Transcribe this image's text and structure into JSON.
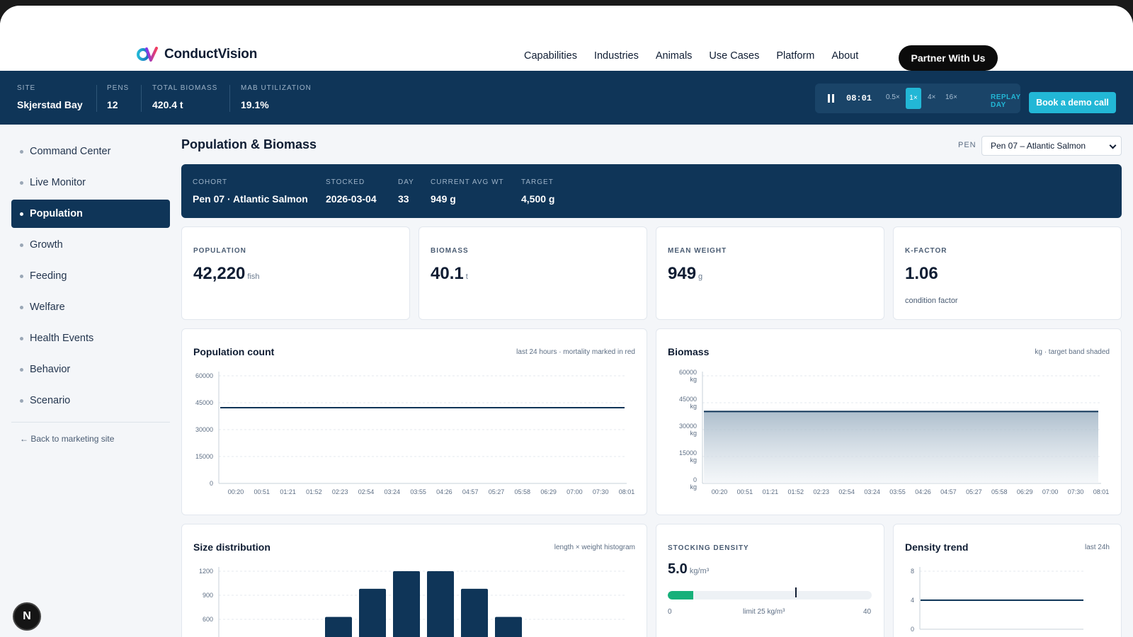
{
  "brand": {
    "name": "ConductVision"
  },
  "nav": {
    "links": [
      "Capabilities",
      "Industries",
      "Animals",
      "Use Cases",
      "Platform",
      "About"
    ],
    "cta": "Partner With Us"
  },
  "infobar": {
    "stats": [
      {
        "label": "SITE",
        "value": "Skjerstad Bay"
      },
      {
        "label": "PENS",
        "value": "12"
      },
      {
        "label": "TOTAL BIOMASS",
        "value": "420.4 t"
      },
      {
        "label": "MAB UTILIZATION",
        "value": "19.1%"
      }
    ],
    "playback": {
      "time": "08:01",
      "speeds": [
        "0.5×",
        "1×",
        "4×",
        "16×"
      ],
      "active_speed": "1×",
      "replay": "REPLAY DAY"
    },
    "demo_cta": "Book a demo call"
  },
  "sidebar": {
    "items": [
      "Command Center",
      "Live Monitor",
      "Population",
      "Growth",
      "Feeding",
      "Welfare",
      "Health Events",
      "Behavior",
      "Scenario"
    ],
    "active": "Population",
    "back": "← Back to marketing site"
  },
  "page": {
    "title": "Population & Biomass",
    "pen_label": "PEN",
    "pen_selected": "Pen 07 – Atlantic Salmon"
  },
  "cohort": [
    {
      "label": "COHORT",
      "value": "Pen 07 · Atlantic Salmon"
    },
    {
      "label": "STOCKED",
      "value": "2026-03-04"
    },
    {
      "label": "DAY",
      "value": "33"
    },
    {
      "label": "CURRENT AVG WT",
      "value": "949 g"
    },
    {
      "label": "TARGET",
      "value": "4,500 g"
    }
  ],
  "kpis": [
    {
      "label": "POPULATION",
      "value": "42,220",
      "unit": "fish",
      "sub": ""
    },
    {
      "label": "BIOMASS",
      "value": "40.1",
      "unit": "t",
      "sub": ""
    },
    {
      "label": "MEAN WEIGHT",
      "value": "949",
      "unit": "g",
      "sub": ""
    },
    {
      "label": "K-FACTOR",
      "value": "1.06",
      "unit": "",
      "sub": "condition factor"
    }
  ],
  "charts": {
    "population": {
      "title": "Population count",
      "note": "last 24 hours · mortality marked in red"
    },
    "biomass": {
      "title": "Biomass",
      "note": "kg · target band shaded"
    },
    "size": {
      "title": "Size distribution",
      "note": "length × weight histogram"
    },
    "density_trend": {
      "title": "Density trend",
      "note": "last 24h"
    }
  },
  "density": {
    "label": "STOCKING DENSITY",
    "value": "5.0",
    "unit": "kg/m³",
    "fill_fraction": 0.125,
    "limit_fraction": 0.625,
    "scale_min": "0",
    "scale_max": "40",
    "limit_label": "limit 25 kg/m³"
  },
  "avatar": "N",
  "colors": {
    "navy": "#0f3558",
    "accent": "#22b7d6",
    "green": "#17b07a"
  },
  "chart_data": [
    {
      "type": "line",
      "title": "Population count",
      "x": [
        "00:20",
        "00:51",
        "01:21",
        "01:52",
        "02:23",
        "02:54",
        "03:24",
        "03:55",
        "04:26",
        "04:57",
        "05:27",
        "05:58",
        "06:29",
        "07:00",
        "07:30",
        "08:01"
      ],
      "series": [
        {
          "values": [
            42220,
            42220,
            42220,
            42220,
            42220,
            42220,
            42220,
            42220,
            42220,
            42220,
            42220,
            42220,
            42220,
            42220,
            42220,
            42220
          ]
        }
      ],
      "yticks": [
        "0",
        "15000",
        "30000",
        "45000",
        "60000"
      ],
      "ylim": [
        0,
        60000
      ],
      "grid": true
    },
    {
      "type": "area",
      "title": "Biomass",
      "x": [
        "00:20",
        "00:51",
        "01:21",
        "01:52",
        "02:23",
        "02:54",
        "03:24",
        "03:55",
        "04:26",
        "04:57",
        "05:27",
        "05:58",
        "06:29",
        "07:00",
        "07:30",
        "08:01"
      ],
      "series": [
        {
          "values": [
            40100,
            40100,
            40100,
            40100,
            40100,
            40100,
            40100,
            40100,
            40100,
            40100,
            40100,
            40100,
            40100,
            40100,
            40100,
            40100
          ]
        }
      ],
      "yticks": [
        "0 kg",
        "15000 kg",
        "30000 kg",
        "45000 kg",
        "60000 kg"
      ],
      "ylim": [
        0,
        60000
      ],
      "grid": true
    },
    {
      "type": "bar",
      "title": "Size distribution",
      "values": [
        0,
        0,
        0,
        630,
        980,
        1200,
        1200,
        980,
        630,
        0,
        0,
        0
      ],
      "yticks": [
        "600",
        "900",
        "1200"
      ],
      "ylim": [
        0,
        1200
      ],
      "grid": true
    },
    {
      "type": "line",
      "title": "Density trend",
      "series": [
        {
          "values": [
            5.0,
            5.0,
            5.0,
            5.0,
            5.0,
            5.0,
            5.0,
            5.0
          ]
        }
      ],
      "yticks": [
        "0",
        "4",
        "8"
      ],
      "ylim": [
        0,
        10
      ],
      "grid": true
    }
  ]
}
